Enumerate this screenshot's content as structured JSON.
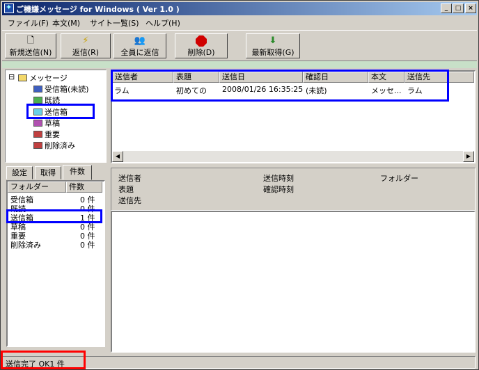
{
  "window": {
    "title": "ご機嫌メッセージ for Windows ( Ver 1.0 )",
    "min": "_",
    "max": "□",
    "close": "×"
  },
  "menu": [
    "ファイル(F)",
    "本文(M)",
    "サイト一覧(S)",
    "ヘルプ(H)"
  ],
  "toolbar": {
    "new": "新規送信(N)",
    "reply": "返信(R)",
    "reply_all": "全員に返信",
    "delete": "削除(D)",
    "stop_badge": "STOP",
    "fetch": "最新取得(G)"
  },
  "tree": {
    "root": "メッセージ",
    "expander": "⊟",
    "items": [
      "受信箱(未読)",
      "既読",
      "送信箱",
      "草稿",
      "重要",
      "削除済み"
    ],
    "colors": [
      "#3f5fbf",
      "#4caf50",
      "#6ad0e6",
      "#b050b0",
      "#c04040",
      "#c04040"
    ]
  },
  "tabs": [
    "設定",
    "取得",
    "件数"
  ],
  "counts": {
    "headers": [
      "フォルダー",
      "件数"
    ],
    "rows": [
      {
        "folder": "受信箱",
        "count": "0 件"
      },
      {
        "folder": "既読",
        "count": "0 件"
      },
      {
        "folder": "送信箱",
        "count": "1 件"
      },
      {
        "folder": "草稿",
        "count": "0 件"
      },
      {
        "folder": "重要",
        "count": "0 件"
      },
      {
        "folder": "削除済み",
        "count": "0 件"
      }
    ]
  },
  "list": {
    "headers": [
      "送信者",
      "表題",
      "送信日",
      "確認日",
      "本文",
      "送信先"
    ],
    "rows": [
      {
        "sender": "ラム",
        "subject": "初めての",
        "sent": "2008/01/26 16:35:25",
        "confirmed": "(未読)",
        "body": "メッセ...",
        "to": "ラム"
      }
    ],
    "scroll_left": "◀",
    "scroll_right": "▶"
  },
  "detail": {
    "sender_label": "送信者",
    "subject_label": "表題",
    "to_label": "送信先",
    "sent_time_label": "送信時刻",
    "confirm_time_label": "確認時刻",
    "folder_label": "フォルダー"
  },
  "status": {
    "text": "送信完了 OK1 件"
  }
}
